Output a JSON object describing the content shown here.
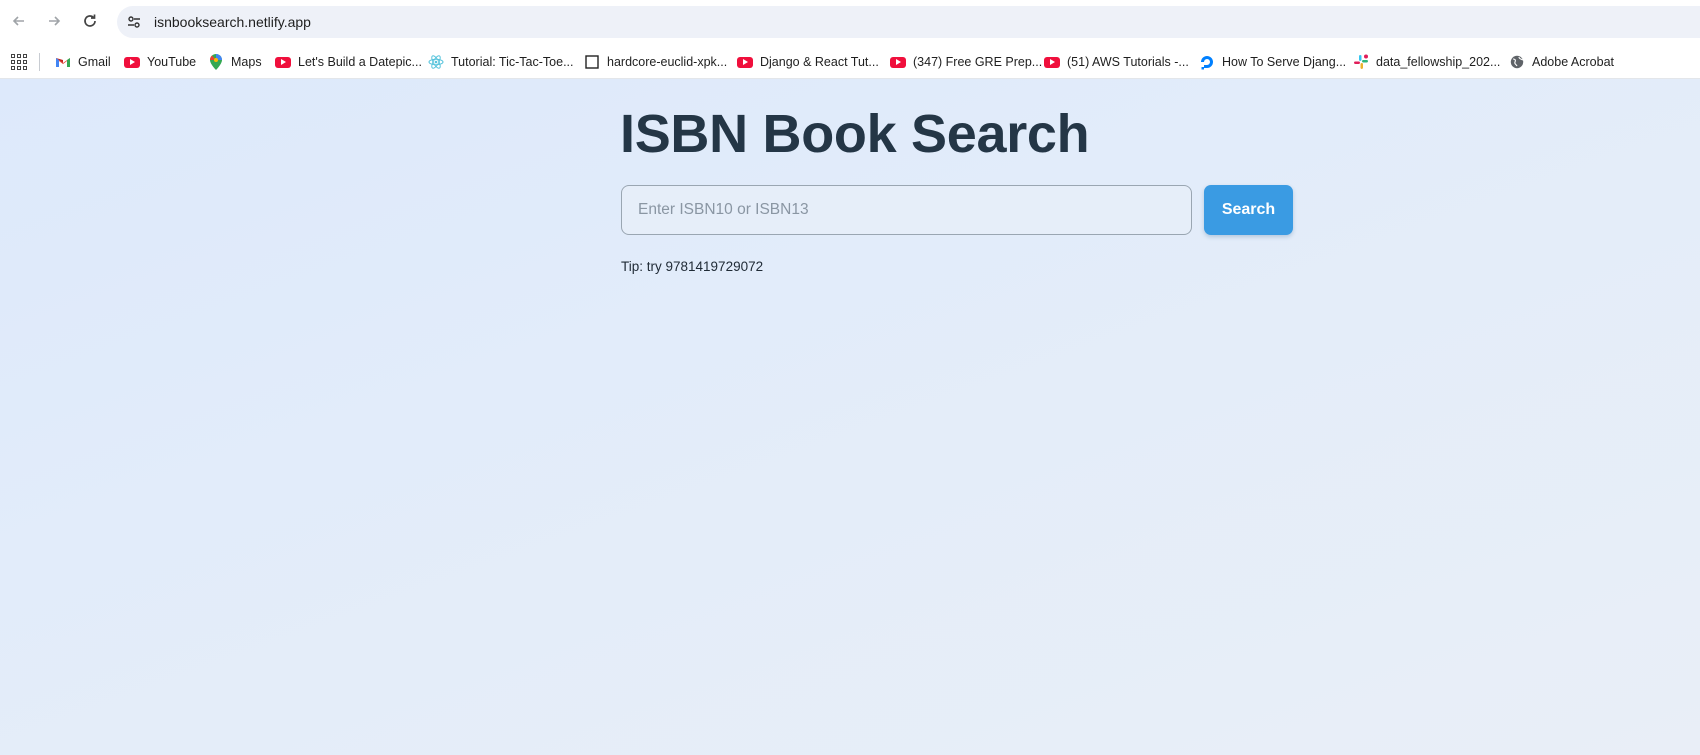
{
  "browser": {
    "url": "isnbooksearch.netlify.app",
    "bookmarks": [
      {
        "label": "Gmail",
        "icon": "gmail-icon"
      },
      {
        "label": "YouTube",
        "icon": "youtube-icon"
      },
      {
        "label": "Maps",
        "icon": "maps-icon"
      },
      {
        "label": "Let's Build a Datepic...",
        "icon": "youtube-icon"
      },
      {
        "label": "Tutorial: Tic-Tac-Toe...",
        "icon": "react-icon"
      },
      {
        "label": "hardcore-euclid-xpk...",
        "icon": "page-icon"
      },
      {
        "label": "Django & React Tut...",
        "icon": "youtube-icon"
      },
      {
        "label": "(347) Free GRE Prep...",
        "icon": "youtube-icon"
      },
      {
        "label": "(51) AWS Tutorials -...",
        "icon": "youtube-icon"
      },
      {
        "label": "How To Serve Djang...",
        "icon": "digitalocean-icon"
      },
      {
        "label": "data_fellowship_202...",
        "icon": "slack-icon"
      },
      {
        "label": "Adobe Acrobat",
        "icon": "globe-icon"
      }
    ]
  },
  "page": {
    "title": "ISBN Book Search",
    "search_placeholder": "Enter ISBN10 or ISBN13",
    "search_value": "",
    "search_button": "Search",
    "tip": "Tip: try 9781419729072"
  },
  "colors": {
    "title": "#243646",
    "button": "#3a9be3",
    "background": "#dde9fb"
  }
}
